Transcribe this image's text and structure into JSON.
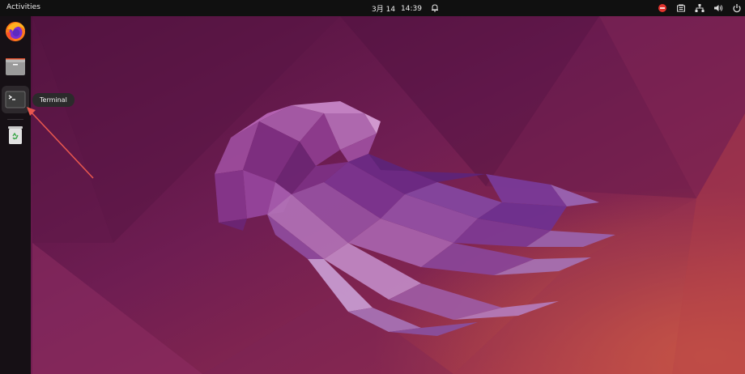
{
  "topbar": {
    "activities_label": "Activities",
    "clock_date": "3月 14",
    "clock_time": "14:39"
  },
  "tray": {
    "icons": [
      "do-not-disturb-icon",
      "app-indicator-icon",
      "network-icon",
      "volume-icon",
      "power-icon"
    ]
  },
  "dock": {
    "apps": [
      {
        "name": "firefox",
        "icon": "firefox-icon"
      },
      {
        "name": "files",
        "icon": "files-icon"
      },
      {
        "name": "terminal",
        "icon": "terminal-icon"
      },
      {
        "name": "trash",
        "icon": "trash-icon"
      }
    ]
  },
  "tooltip": {
    "label": "Terminal"
  },
  "colors": {
    "ubuntu_orange": "#e95420",
    "topbar": "#101010",
    "dock": "#161015",
    "wallpaper_base": "#6e1d52",
    "annotation_arrow": "#e8574f"
  }
}
